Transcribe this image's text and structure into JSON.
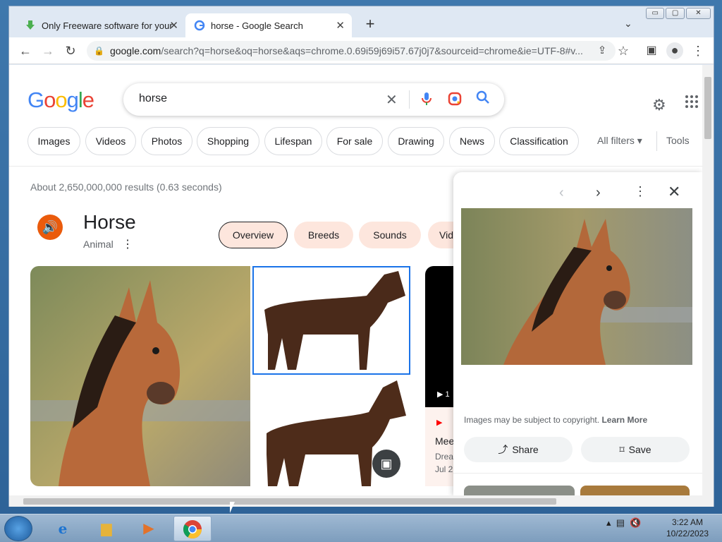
{
  "browser": {
    "tabs": [
      {
        "title": "Only Freeware software for your"
      },
      {
        "title": "horse - Google Search"
      }
    ],
    "url_host": "google.com",
    "url_rest": "/search?q=horse&oq=horse&aqs=chrome.0.69i59j69i57.67j0j7&sourceid=chrome&ie=UTF-8#v...",
    "new_tab_glyph": "+",
    "window_controls": {
      "minimize": "▭",
      "maximize": "▢",
      "close": "✕"
    }
  },
  "search": {
    "logo": [
      "G",
      "o",
      "o",
      "g",
      "l",
      "e"
    ],
    "logo_colors": [
      "#4285f4",
      "#ea4335",
      "#fbbc05",
      "#4285f4",
      "#34a853",
      "#ea4335"
    ],
    "query": "horse",
    "chips": [
      "Images",
      "Videos",
      "Photos",
      "Shopping",
      "Lifespan",
      "For sale",
      "Drawing",
      "News",
      "Classification"
    ],
    "all_filters": "All filters ▾",
    "tools": "Tools",
    "stats": "About 2,650,000,000 results (0.63 seconds)"
  },
  "knowledge_panel": {
    "title": "Horse",
    "subtitle": "Animal",
    "more": "⋮",
    "tabs": [
      "Overview",
      "Breeds",
      "Sounds",
      "Vid"
    ],
    "accent_color": "#ea5b0c"
  },
  "video_card": {
    "play": "▶ 1",
    "source_icon": "▶",
    "title": "Mee",
    "source": "Drea",
    "date": "Jul 2"
  },
  "side_panel": {
    "copyright_text": "Images may be subject to copyright.",
    "learn_more": "Learn More",
    "share": "Share",
    "save": "Save"
  },
  "taskbar": {
    "time": "3:22 AM",
    "date": "10/22/2023"
  }
}
